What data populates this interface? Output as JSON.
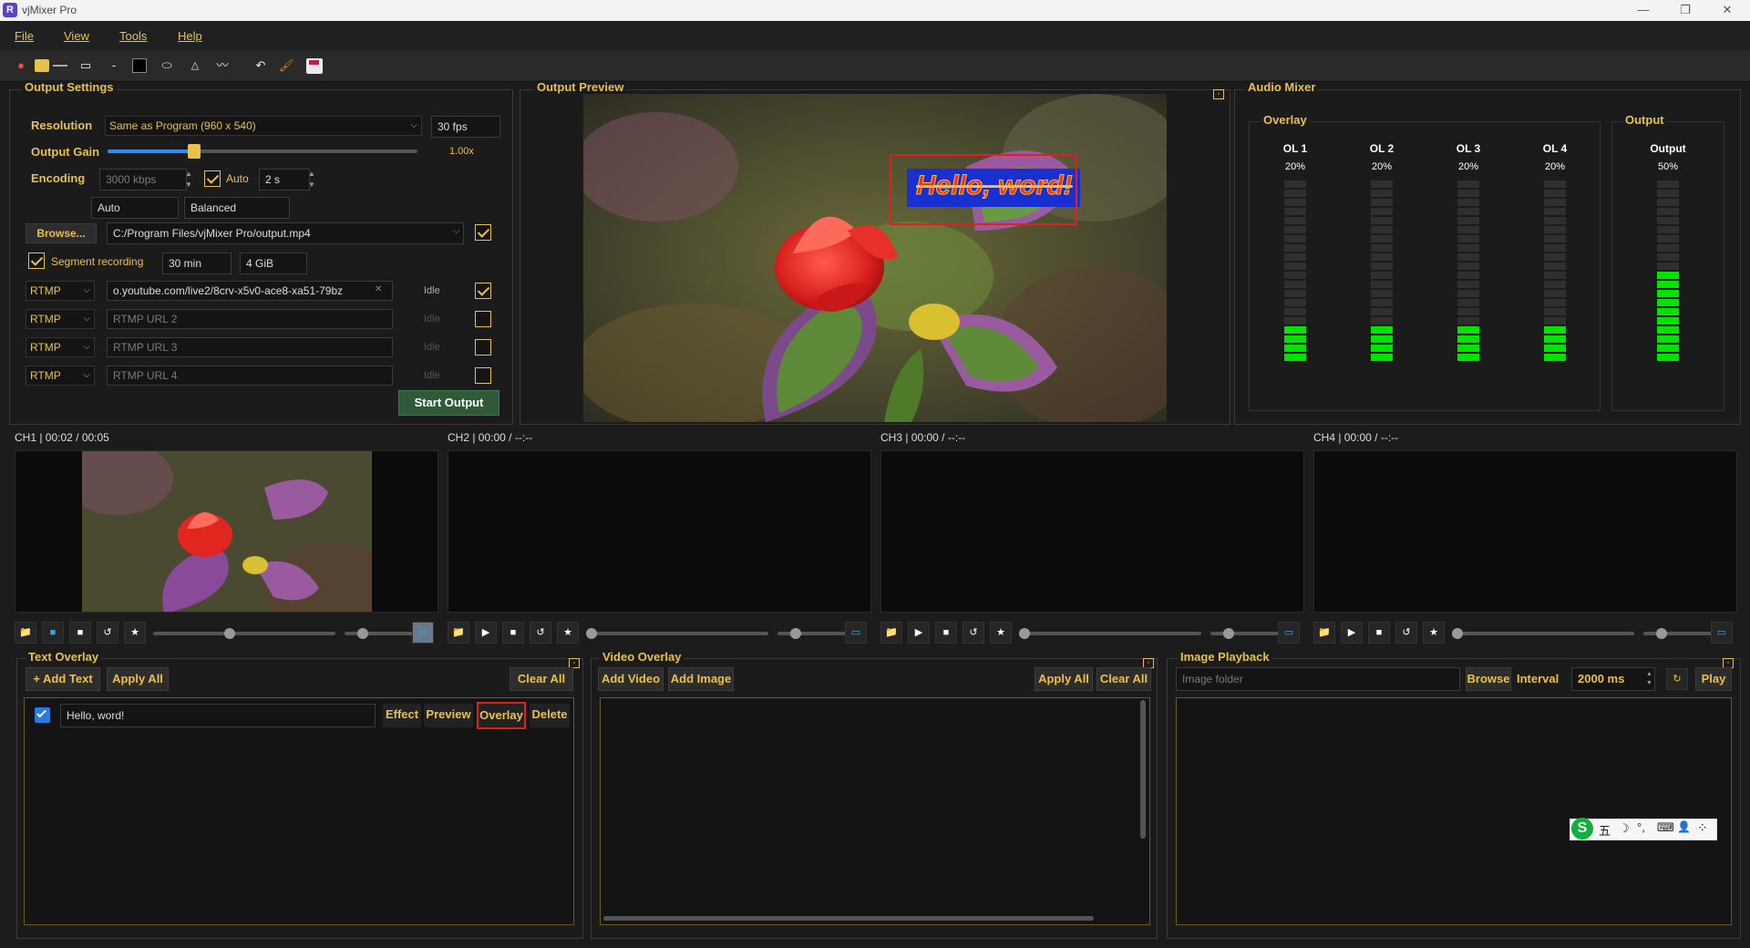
{
  "window": {
    "title": "vjMixer Pro",
    "logo": "R"
  },
  "menu": [
    "File",
    "View",
    "Tools",
    "Help"
  ],
  "colors": {
    "accent": "#e8c14a",
    "meter_green": "#00e400",
    "highlight_red": "#e0201c"
  },
  "output_settings": {
    "title": "Output Settings",
    "resolution_label": "Resolution",
    "resolution_value": "Same as Program (960 x 540)",
    "fps_value": "30 fps",
    "gain_label": "Output Gain",
    "gain_value": "1.00x",
    "gain_level": 0.28,
    "encoding_label": "Encoding",
    "bitrate_value": "3000 kbps",
    "auto_label": "Auto",
    "auto_checked": true,
    "keyframe_value": "2 s",
    "encoder_value": "Auto",
    "preset_value": "Balanced",
    "browse_label": "Browse...",
    "path_value": "C:/Program Files/vjMixer Pro/output.mp4",
    "path_checked": true,
    "segment_label": "Segment recording",
    "segment_checked": true,
    "segment_time": "30 min",
    "segment_size": "4 GiB",
    "rtmp_rows": [
      {
        "protocol": "RTMP",
        "url": "o.youtube.com/live2/8crv-x5v0-ace8-xa51-79bz",
        "placeholder": "",
        "status": "Idle",
        "checked": true
      },
      {
        "protocol": "RTMP",
        "url": "",
        "placeholder": "RTMP URL 2",
        "status": "Idle",
        "checked": false
      },
      {
        "protocol": "RTMP",
        "url": "",
        "placeholder": "RTMP URL 3",
        "status": "Idle",
        "checked": false
      },
      {
        "protocol": "RTMP",
        "url": "",
        "placeholder": "RTMP URL 4",
        "status": "Idle",
        "checked": false
      }
    ],
    "start_button": "Start Output"
  },
  "output_preview": {
    "title": "Output Preview",
    "overlay_text": "Hello, word!"
  },
  "audio_mixer": {
    "title": "Audio Mixer",
    "overlay_group": "Overlay",
    "output_group": "Output",
    "channels": [
      {
        "name": "OL 1",
        "percent": "20%",
        "level": 0.2
      },
      {
        "name": "OL 2",
        "percent": "20%",
        "level": 0.2
      },
      {
        "name": "OL 3",
        "percent": "20%",
        "level": 0.2
      },
      {
        "name": "OL 4",
        "percent": "20%",
        "level": 0.2
      }
    ],
    "output": {
      "name": "Output",
      "percent": "50%",
      "level": 0.5
    }
  },
  "channels": [
    {
      "label": "CH1 | 00:02 / 00:05",
      "has_image": true
    },
    {
      "label": "CH2 | 00:00 / --:--",
      "has_image": false
    },
    {
      "label": "CH3 | 00:00 / --:--",
      "has_image": false
    },
    {
      "label": "CH4 | 00:00 / --:--",
      "has_image": false
    }
  ],
  "text_overlay": {
    "title": "Text Overlay",
    "add_text": "+ Add Text",
    "apply_all": "Apply All",
    "clear_all": "Clear All",
    "item_text": "Hello, word!",
    "item_checked": true,
    "effect": "Effect",
    "preview": "Preview",
    "overlay": "Overlay",
    "delete": "Delete"
  },
  "video_overlay": {
    "title": "Video Overlay",
    "add_video": "Add Video",
    "add_image": "Add Image",
    "apply_all": "Apply All",
    "clear_all": "Clear All"
  },
  "image_playback": {
    "title": "Image Playback",
    "folder_placeholder": "Image folder",
    "browse": "Browse",
    "interval_label": "Interval",
    "interval_value": "2000 ms",
    "play": "Play"
  },
  "ime_bar": {
    "items": [
      "S",
      "五",
      "☽",
      "°,",
      "⌨",
      "👤",
      "⁘"
    ]
  }
}
